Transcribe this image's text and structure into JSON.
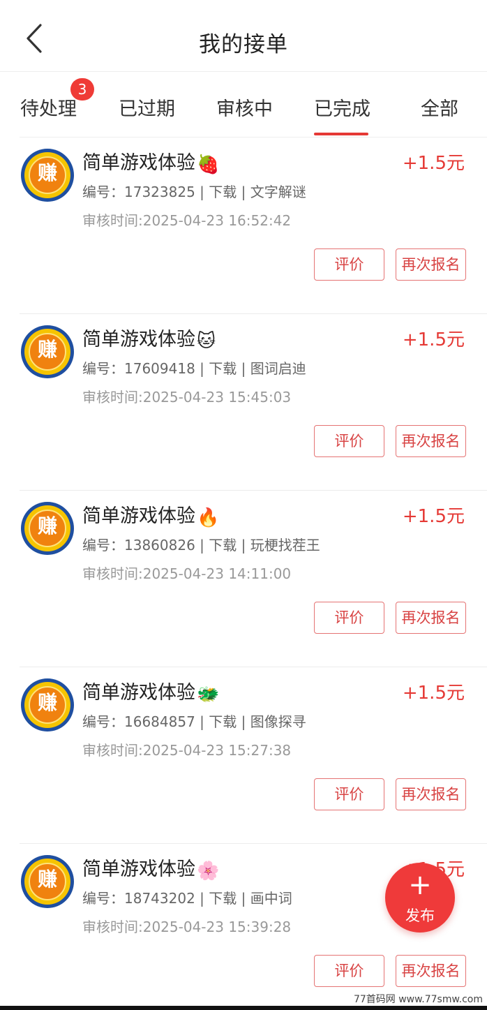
{
  "header": {
    "title": "我的接单"
  },
  "tabs": [
    {
      "label": "待处理",
      "badge": "3"
    },
    {
      "label": "已过期"
    },
    {
      "label": "审核中"
    },
    {
      "label": "已完成",
      "active": true
    },
    {
      "label": "全部"
    }
  ],
  "colors": {
    "accent": "#e53935",
    "badge": "#ef3b36"
  },
  "items": [
    {
      "avatar_glyph": "赚",
      "name": "简单游戏体验",
      "emoji": "🍓",
      "reward": "+1.5元",
      "meta": "编号：17323825 | 下载 | 文字解谜",
      "time": "审核时间:2025-04-23 16:52:42",
      "rate_label": "评价",
      "again_label": "再次报名"
    },
    {
      "avatar_glyph": "赚",
      "name": "简单游戏体验",
      "emoji": "🐱",
      "reward": "+1.5元",
      "meta": "编号：17609418 | 下载 | 图词启迪",
      "time": "审核时间:2025-04-23 15:45:03",
      "rate_label": "评价",
      "again_label": "再次报名"
    },
    {
      "avatar_glyph": "赚",
      "name": "简单游戏体验",
      "emoji": "🔥",
      "reward": "+1.5元",
      "meta": "编号：13860826 | 下载 | 玩梗找茬王",
      "time": "审核时间:2025-04-23 14:11:00",
      "rate_label": "评价",
      "again_label": "再次报名"
    },
    {
      "avatar_glyph": "赚",
      "name": "简单游戏体验",
      "emoji": "🐲",
      "reward": "+1.5元",
      "meta": "编号：16684857 | 下载 | 图像探寻",
      "time": "审核时间:2025-04-23 15:27:38",
      "rate_label": "评价",
      "again_label": "再次报名"
    },
    {
      "avatar_glyph": "赚",
      "name": "简单游戏体验",
      "emoji": "🌸",
      "reward": "+1.5元",
      "meta": "编号：18743202 | 下载 | 画中词",
      "time": "审核时间:2025-04-23 15:39:28",
      "rate_label": "评价",
      "again_label": "再次报名"
    }
  ],
  "fab": {
    "plus": "+",
    "label": "发布"
  },
  "watermark": "77首码网 www.77smw.com"
}
